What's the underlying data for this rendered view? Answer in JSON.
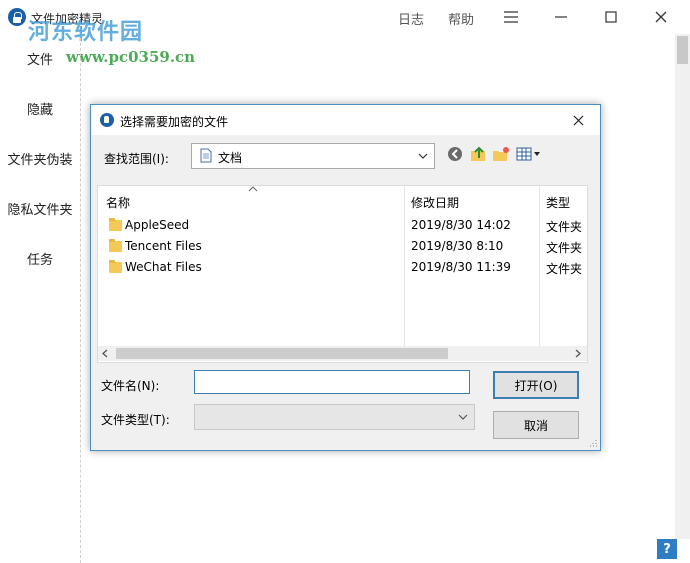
{
  "app": {
    "title": "文件加密精灵",
    "watermark": "河东软件园",
    "watermark_url": "www.pc0359.cn",
    "top_links": [
      "日志",
      "帮助"
    ],
    "help_icon": "?"
  },
  "sidebar": {
    "items": [
      {
        "label": "文件"
      },
      {
        "label": "隐藏"
      },
      {
        "label": "文件夹伪装"
      },
      {
        "label": "隐私文件夹"
      },
      {
        "label": "任务"
      }
    ]
  },
  "dialog": {
    "title": "选择需要加密的文件",
    "lookin_label": "查找范围(I):",
    "lookin_value": "文档",
    "columns": {
      "name": "名称",
      "modified": "修改日期",
      "type": "类型"
    },
    "files": [
      {
        "name": "AppleSeed",
        "modified": "2019/8/30 14:02",
        "type": "文件夹"
      },
      {
        "name": "Tencent Files",
        "modified": "2019/8/30 8:10",
        "type": "文件夹"
      },
      {
        "name": "WeChat Files",
        "modified": "2019/8/30 11:39",
        "type": "文件夹"
      }
    ],
    "filename_label": "文件名(N):",
    "filename_value": "",
    "filetype_label": "文件类型(T):",
    "filetype_value": "",
    "open_button": "打开(O)",
    "cancel_button": "取消"
  },
  "colors": {
    "accent": "#3c7fb1",
    "dialog_border": "#4a8ec8",
    "watermark_blue": "#4aa0d8",
    "watermark_green": "#3aa346",
    "folder": "#f4c957"
  }
}
